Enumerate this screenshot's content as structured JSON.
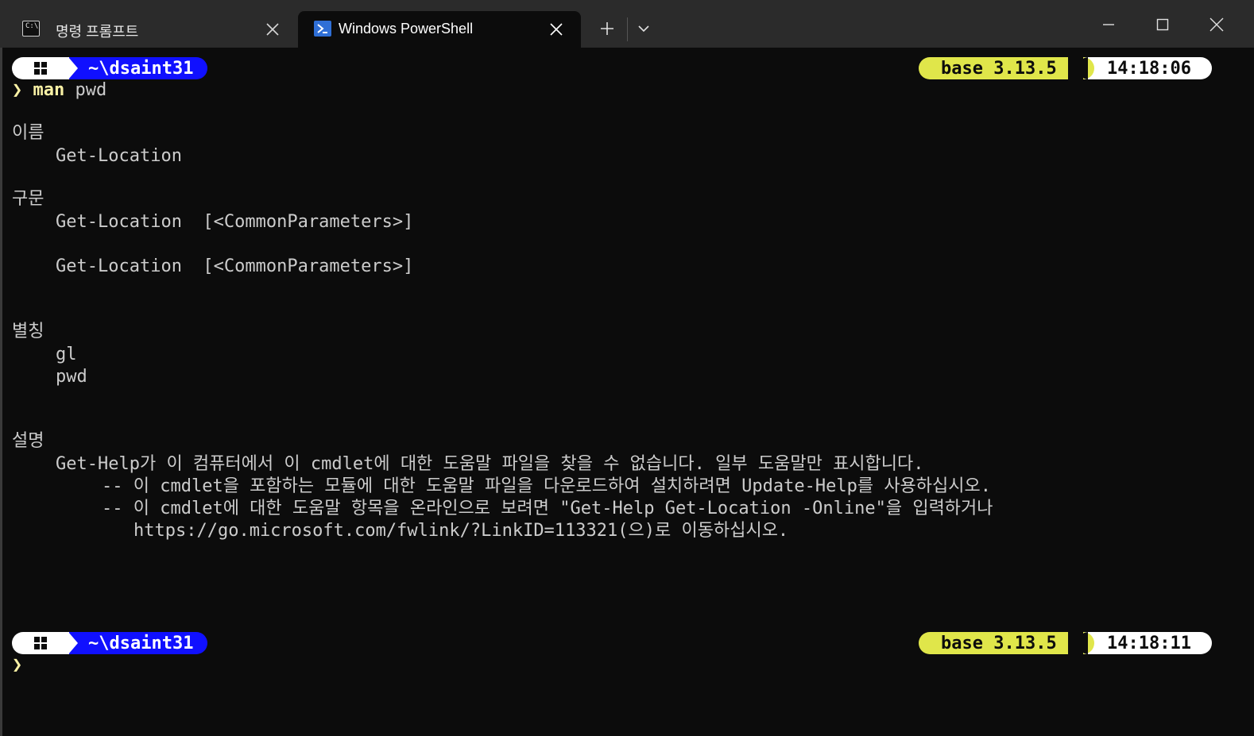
{
  "tabs": [
    {
      "label": "명령 프롬프트",
      "icon": "cmd-icon",
      "active": false
    },
    {
      "label": "Windows PowerShell",
      "icon": "powershell-icon",
      "active": true
    }
  ],
  "tab_bar": {
    "new_tab_icon": "plus-icon",
    "dropdown_icon": "chevron-down-icon"
  },
  "window_controls": [
    "minimize-icon",
    "maximize-icon",
    "close-icon"
  ],
  "cmd_icon_text": "C:\\",
  "prompt1": {
    "path": "~\\dsaint31",
    "env": "base 3.13.5",
    "time": "14:18:06",
    "chevron": "❯",
    "command": "man",
    "argument": "pwd"
  },
  "help": {
    "name_header": "이름",
    "name_value": "Get-Location",
    "syntax_header": "구문",
    "syntax_line1": "Get-Location  [<CommonParameters>]",
    "syntax_line2": "Get-Location  [<CommonParameters>]",
    "alias_header": "별칭",
    "alias1": "gl",
    "alias2": "pwd",
    "desc_header": "설명",
    "desc_line1": "Get-Help가 이 컴퓨터에서 이 cmdlet에 대한 도움말 파일을 찾을 수 없습니다. 일부 도움말만 표시합니다.",
    "desc_line2": "-- 이 cmdlet을 포함하는 모듈에 대한 도움말 파일을 다운로드하여 설치하려면 Update-Help를 사용하십시오.",
    "desc_line3": "-- 이 cmdlet에 대한 도움말 항목을 온라인으로 보려면 \"Get-Help Get-Location -Online\"을 입력하거나",
    "desc_line4": "https://go.microsoft.com/fwlink/?LinkID=113321(으)로 이동하십시오."
  },
  "prompt2": {
    "path": "~\\dsaint31",
    "env": "base 3.13.5",
    "time": "14:18:11",
    "chevron": "❯"
  },
  "colors": {
    "background": "#0c0c0c",
    "text": "#cccccc",
    "path_segment": "#1010ff",
    "env_segment": "#e0e64a",
    "prompt_chevron": "#f9f1a5"
  }
}
